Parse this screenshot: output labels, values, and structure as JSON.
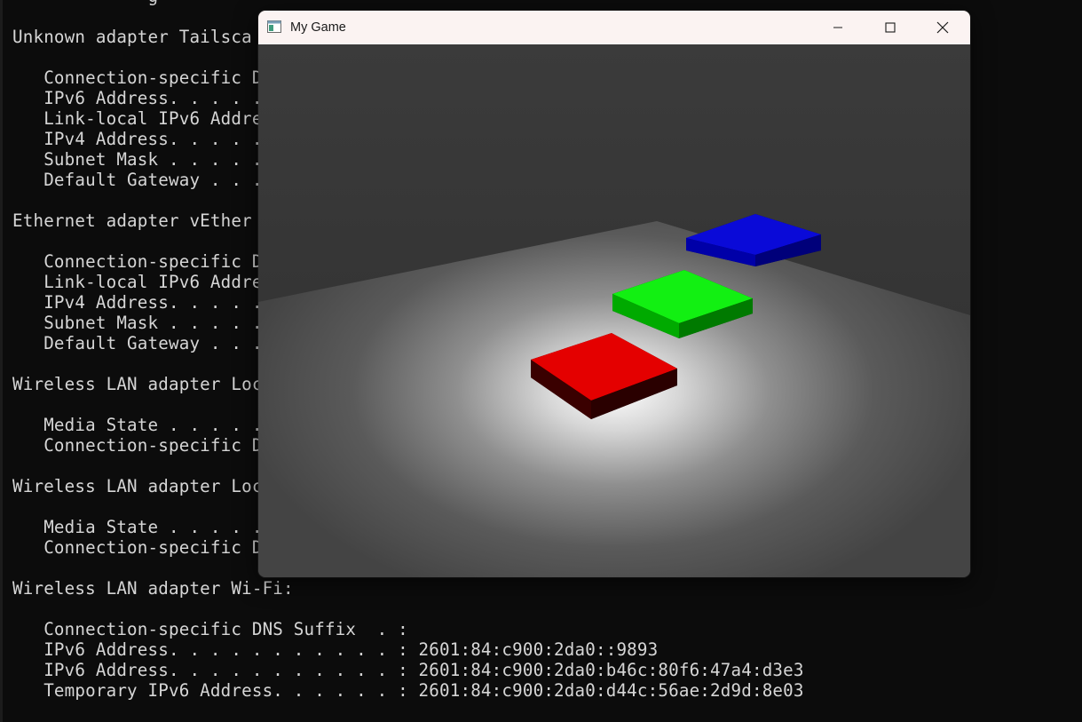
{
  "terminal": {
    "lines": [
      {
        "text": "             g"
      },
      {
        "text": ""
      },
      {
        "text": "Unknown adapter Tailsca"
      },
      {
        "text": ""
      },
      {
        "text": "   Connection-specific D"
      },
      {
        "text": "   IPv6 Address. . . . ."
      },
      {
        "text": "   Link-local IPv6 Addre"
      },
      {
        "text": "   IPv4 Address. . . . ."
      },
      {
        "text": "   Subnet Mask . . . . ."
      },
      {
        "text": "   Default Gateway . . ."
      },
      {
        "text": ""
      },
      {
        "text": "Ethernet adapter vEther"
      },
      {
        "text": ""
      },
      {
        "text": "   Connection-specific D"
      },
      {
        "text": "   Link-local IPv6 Addre"
      },
      {
        "text": "   IPv4 Address. . . . ."
      },
      {
        "text": "   Subnet Mask . . . . ."
      },
      {
        "text": "   Default Gateway . . ."
      },
      {
        "text": ""
      },
      {
        "text": "Wireless LAN adapter Loc"
      },
      {
        "text": ""
      },
      {
        "text": "   Media State . . . . ."
      },
      {
        "text": "   Connection-specific D"
      },
      {
        "text": ""
      },
      {
        "text": "Wireless LAN adapter Loc"
      },
      {
        "text": ""
      },
      {
        "text": "   Media State . . . . ."
      },
      {
        "text": "   Connection-specific D"
      },
      {
        "text": ""
      },
      {
        "text": "Wireless LAN adapter Wi-Fi:"
      },
      {
        "text": ""
      },
      {
        "text": "   Connection-specific DNS Suffix  . :"
      },
      {
        "text": "   IPv6 Address. . . . . . . . . . . : 2601:84:c900:2da0::9893"
      },
      {
        "text": "   IPv6 Address. . . . . . . . . . . : 2601:84:c900:2da0:b46c:80f6:47a4:d3e3"
      },
      {
        "text": "   Temporary IPv6 Address. . . . . . : 2601:84:c900:2da0:d44c:56ae:2d9d:8e03"
      }
    ]
  },
  "window": {
    "title": "My Game",
    "icon": "app-window-icon",
    "controls": [
      "minimize-icon",
      "maximize-icon",
      "close-icon"
    ]
  },
  "scene": {
    "floor_color": "#5a5a5a",
    "spotlight_color": "#ffffff",
    "boxes": [
      {
        "color": "red",
        "hex": "#e00000"
      },
      {
        "color": "green",
        "hex": "#00e000"
      },
      {
        "color": "blue",
        "hex": "#0000e6"
      }
    ]
  }
}
